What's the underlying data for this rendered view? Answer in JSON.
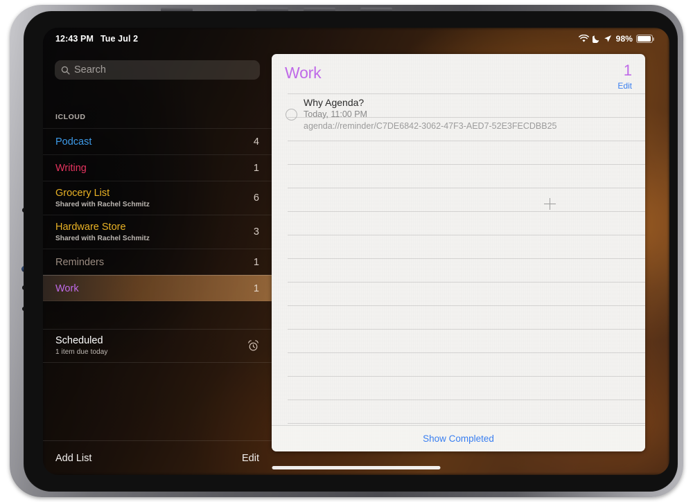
{
  "status_bar": {
    "time": "12:43 PM",
    "date": "Tue Jul 2",
    "wifi_icon": "wifi-icon",
    "dnd_icon": "crescent-moon-icon",
    "location_icon": "location-arrow-icon",
    "battery_percent": "98%",
    "battery_icon": "battery-icon"
  },
  "sidebar": {
    "search": {
      "placeholder": "Search",
      "value": "",
      "icon": "search-icon"
    },
    "section_header": "ICLOUD",
    "lists": [
      {
        "name": "Podcast",
        "subtitle": "",
        "count": "4",
        "color": "#3d9ae8"
      },
      {
        "name": "Writing",
        "subtitle": "",
        "count": "1",
        "color": "#e6335f"
      },
      {
        "name": "Grocery List",
        "subtitle": "Shared with Rachel Schmitz",
        "count": "6",
        "color": "#e9b225"
      },
      {
        "name": "Hardware Store",
        "subtitle": "Shared with Rachel Schmitz",
        "count": "3",
        "color": "#e9b225"
      },
      {
        "name": "Reminders",
        "subtitle": "",
        "count": "1",
        "color": "#9a8b80"
      },
      {
        "name": "Work",
        "subtitle": "",
        "count": "1",
        "color": "#bf6ae8",
        "selected": true
      }
    ],
    "smart_lists": [
      {
        "name": "Scheduled",
        "subtitle": "1 item due today",
        "icon": "alarm-clock-icon"
      }
    ],
    "toolbar": {
      "add_list_label": "Add List",
      "edit_label": "Edit"
    }
  },
  "detail": {
    "title": "Work",
    "title_color": "#bf6ae8",
    "count": "1",
    "edit_label": "Edit",
    "edit_color": "#3a7ff0",
    "reminders": [
      {
        "title": "Why Agenda?",
        "due": "Today, 11:00 PM",
        "note": "agenda://reminder/C7DE6842-3062-47F3-AED7-52E3FECDBB25",
        "completed": false
      }
    ],
    "add_item_icon": "plus-icon",
    "show_completed_label": "Show Completed",
    "show_completed_color": "#3a7ff0"
  }
}
